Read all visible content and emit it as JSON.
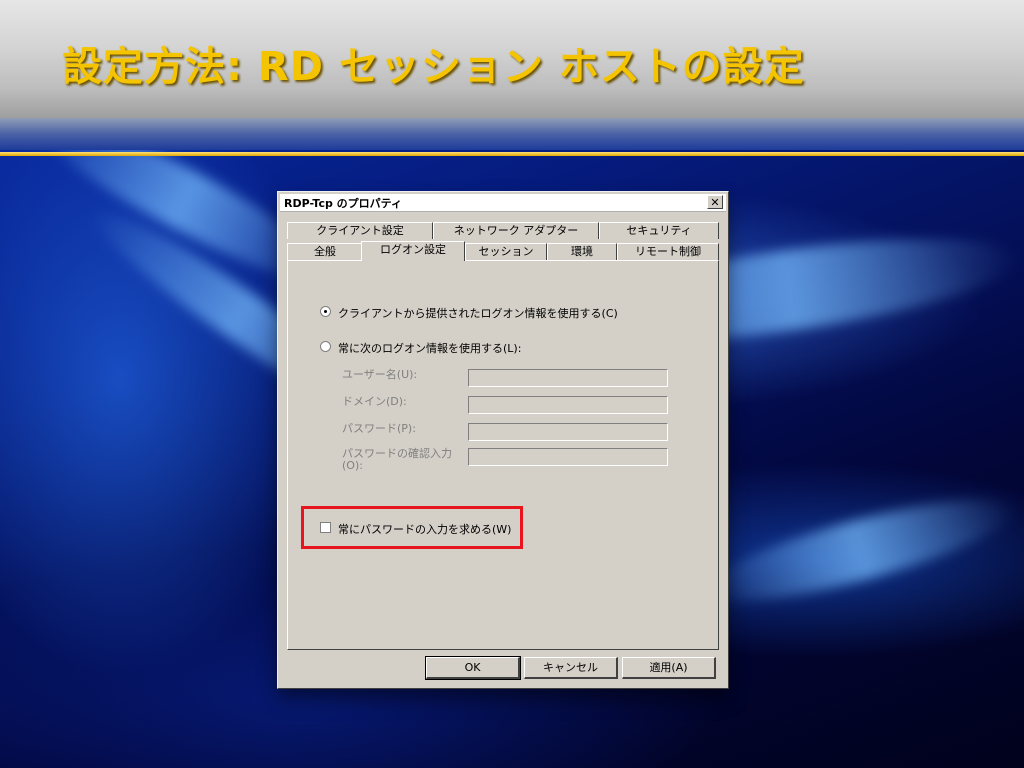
{
  "slide": {
    "title": "設定方法: RD セッション ホストの設定",
    "colors": {
      "title": "#f5c400",
      "gold_line": "#e0a800",
      "highlight": "#e8141e"
    }
  },
  "dialog": {
    "title": "RDP-Tcp のプロパティ",
    "close_glyph": "✕",
    "tabs_row1": [
      "クライアント設定",
      "ネットワーク アダプター",
      "セキュリティ"
    ],
    "tabs_row2": [
      "全般",
      "ログオン設定",
      "セッション",
      "環境",
      "リモート制御"
    ],
    "active_tab": "ログオン設定",
    "radio_client": "クライアントから提供されたログオン情報を使用する(C)",
    "radio_always": "常に次のログオン情報を使用する(L):",
    "fields": {
      "username_label": "ユーザー名(U):",
      "domain_label": "ドメイン(D):",
      "password_label": "パスワード(P):",
      "confirm_label_line1": "パスワードの確認入力",
      "confirm_label_line2": "(O):"
    },
    "checkbox_prompt_password": "常にパスワードの入力を求める(W)",
    "buttons": {
      "ok": "OK",
      "cancel": "キャンセル",
      "apply": "適用(A)"
    }
  }
}
